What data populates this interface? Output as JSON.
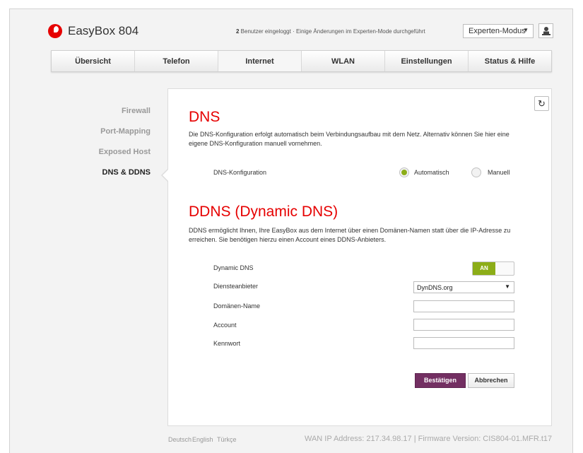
{
  "header": {
    "brand": "EasyBox 804",
    "status_count": "2",
    "status_text": " Benutzer eingeloggt · Einige Änderungen im Experten-Mode durchgeführt",
    "mode_select": "Experten-Modus"
  },
  "nav": {
    "tabs": [
      {
        "label": "Übersicht"
      },
      {
        "label": "Telefon"
      },
      {
        "label": "Internet"
      },
      {
        "label": "WLAN"
      },
      {
        "label": "Einstellungen"
      },
      {
        "label": "Status & Hilfe"
      }
    ],
    "active": "Internet"
  },
  "sidebar": {
    "items": [
      {
        "label": "Firewall"
      },
      {
        "label": "Port-Mapping"
      },
      {
        "label": "Exposed Host"
      },
      {
        "label": "DNS & DDNS"
      }
    ],
    "active": "DNS & DDNS"
  },
  "dns": {
    "title": "DNS",
    "description": "Die DNS-Konfiguration erfolgt automatisch beim Verbindungsaufbau mit dem Netz. Alternativ können Sie hier eine eigene DNS-Konfiguration manuell vornehmen.",
    "config_label": "DNS-Konfiguration",
    "option_auto": "Automatisch",
    "option_manual": "Manuell",
    "selected": "Automatisch"
  },
  "ddns": {
    "title": "DDNS (Dynamic DNS)",
    "description": "DDNS ermöglicht Ihnen, Ihre EasyBox aus dem Internet über einen Domänen-Namen statt über die IP-Adresse zu erreichen. Sie benötigen hierzu einen Account eines DDNS-Anbieters.",
    "dynamic_dns_label": "Dynamic DNS",
    "toggle_value": "AN",
    "provider_label": "Diensteanbieter",
    "provider_value": "DynDNS.org",
    "domain_label": "Domänen-Name",
    "domain_value": "",
    "account_label": "Account",
    "account_value": "",
    "password_label": "Kennwort",
    "password_value": ""
  },
  "buttons": {
    "confirm": "Bestätigen",
    "cancel": "Abbrechen"
  },
  "footer": {
    "languages": [
      "Deutsch",
      "English",
      "Türkçe"
    ],
    "info": "WAN IP Address: 217.34.98.17 | Firmware Version: CIS804-01.MFR.t17"
  },
  "colors": {
    "brand_red": "#e60000",
    "accent_green": "#8cad18",
    "primary_button": "#732f62"
  }
}
